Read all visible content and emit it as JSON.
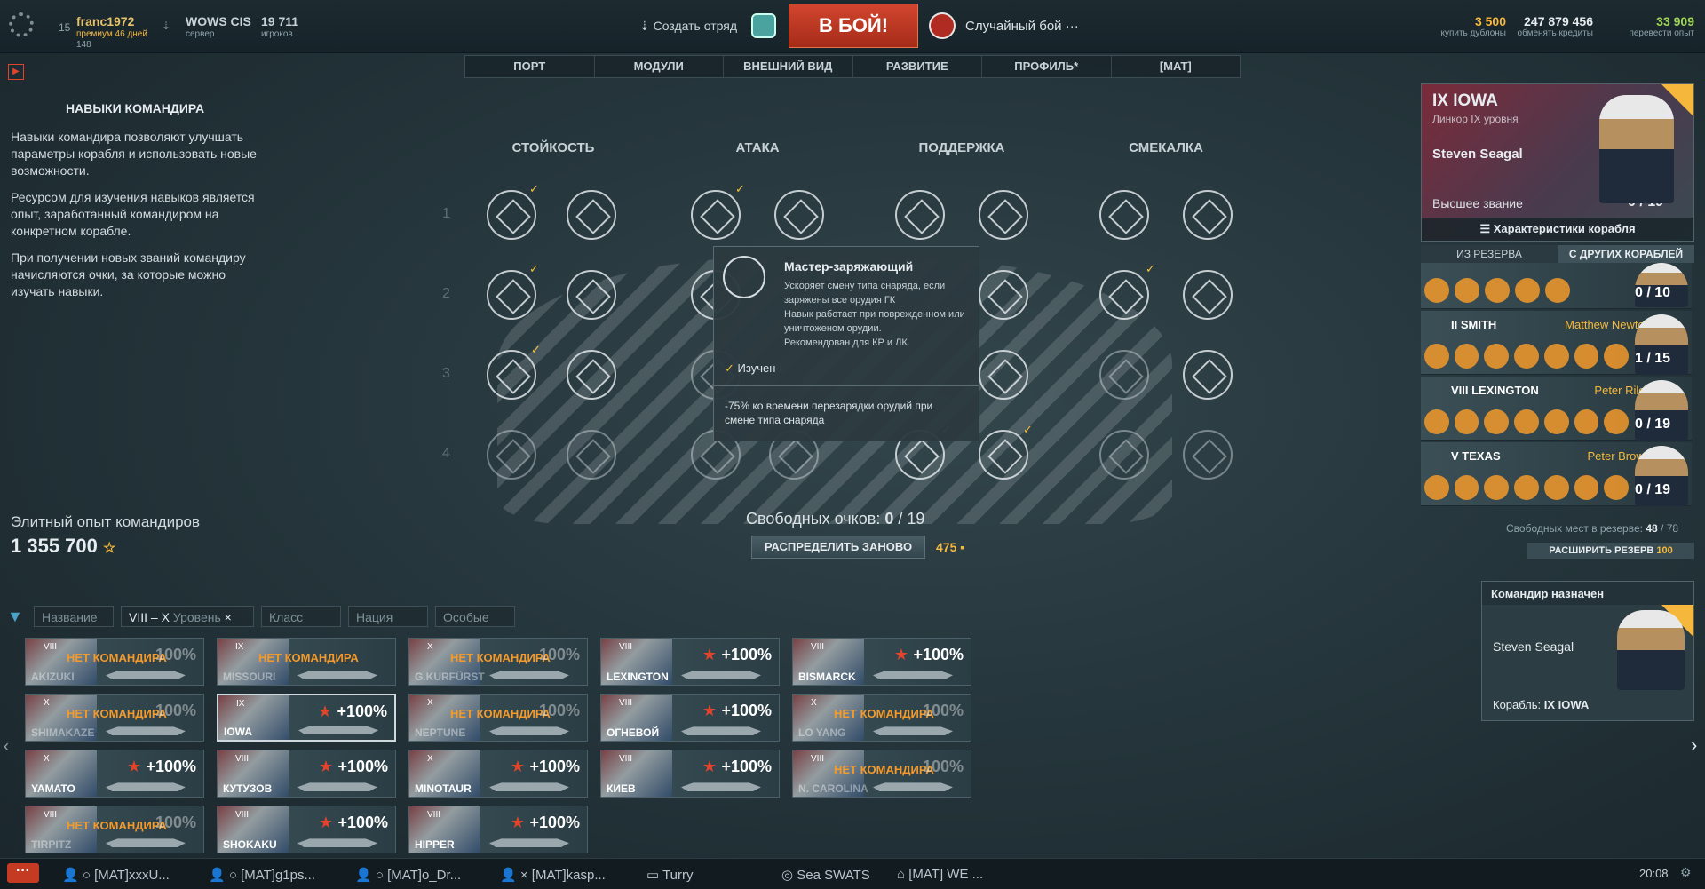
{
  "header": {
    "user": {
      "level": "15",
      "name": "franc1972",
      "premium": "премиум 46 дней",
      "exp": "148"
    },
    "server": {
      "name": "WOWS CIS",
      "label": "сервер"
    },
    "players": {
      "count": "19 711",
      "label": "игроков"
    },
    "create_squad": "Создать отряд",
    "battle_button": "В БОЙ!",
    "battle_mode": "Случайный бой",
    "currency": [
      {
        "value": "3 500",
        "label": "купить дублоны",
        "color": "#f5b83d"
      },
      {
        "value": "247 879 456",
        "label": "обменять кредиты",
        "color": "#e6ecef"
      },
      {
        "value": "33 909",
        "label": "перевести опыт",
        "color": "#9fd35a"
      }
    ]
  },
  "nav": {
    "tabs": [
      "ПОРТ",
      "МОДУЛИ",
      "ВНЕШНИЙ ВИД",
      "РАЗВИТИЕ",
      "ПРОФИЛЬ*"
    ],
    "clan": "[MAT]"
  },
  "info": {
    "title": "НАВЫКИ КОМАНДИРА",
    "p1": "Навыки командира позволяют улучшать параметры корабля и использовать новые возможности.",
    "p2": "Ресурсом для изучения навыков является опыт, заработанный командиром на конкретном корабле.",
    "p3": "При получении новых званий командиру начисляются очки, за которые можно изучать навыки.",
    "elite_label": "Элитный опыт командиров",
    "elite_value": "1 355 700"
  },
  "skills": {
    "columns": [
      "СТОЙКОСТЬ",
      "АТАКА",
      "ПОДДЕРЖКА",
      "СМЕКАЛКА"
    ],
    "rows": [
      "1",
      "2",
      "3",
      "4"
    ],
    "free_points_label": "Свободных очков:",
    "free_points": "0",
    "free_points_max": "19",
    "redistribute": "РАСПРЕДЕЛИТЬ ЗАНОВО",
    "redistribute_cost": "475"
  },
  "tooltip": {
    "title": "Мастер-заряжающий",
    "desc": "Ускоряет смену типа снаряда, если заряжены все орудия ГК\nНавык работает при поврежденном или уничтоженом орудии.\nРекомендован для КР и ЛК.",
    "status": "Изучен",
    "effect": "-75% ко времени перезарядки орудий при смене типа снаряда"
  },
  "commander": {
    "ship": "IX IOWA",
    "ship_type": "Линкор IX уровня",
    "name": "Steven Seagal",
    "rank": "Высшее звание",
    "points": "0 / 19",
    "ship_stats": "Характеристики корабля",
    "tab_reserve": "ИЗ РЕЗЕРВА",
    "tab_other": "С ДРУГИХ КОРАБЛЕЙ"
  },
  "reserve": [
    {
      "ship": "",
      "name": "",
      "points": "0 / 10"
    },
    {
      "ship": "II SMITH",
      "name": "Matthew Newton",
      "points": "1 / 15"
    },
    {
      "ship": "VIII LEXINGTON",
      "name": "Peter Riley",
      "points": "0 / 19"
    },
    {
      "ship": "V TEXAS",
      "name": "Peter Brown",
      "points": "0 / 19"
    }
  ],
  "reserve_free_label": "Свободных мест в резерве:",
  "reserve_free": "48",
  "reserve_max": "78",
  "expand_reserve": "РАСШИРИТЬ РЕЗЕРВ",
  "expand_cost": "100",
  "assigned": {
    "title": "Командир назначен",
    "name": "Steven Seagal",
    "ship_label": "Корабль:",
    "ship": "IX IOWA"
  },
  "filters": {
    "name": "Название",
    "tier_from": "VIII",
    "tier_dash": "–",
    "tier_to": "X",
    "tier": "Уровень",
    "class": "Класс",
    "nation": "Нация",
    "special": "Особые"
  },
  "nocmd": "НЕТ КОМАНДИРА",
  "ships": [
    {
      "tier": "VIII",
      "name": "AKIZUKI",
      "bonus": "100%",
      "nocmd": true
    },
    {
      "tier": "IX",
      "name": "MISSOURI",
      "bonus": "",
      "nocmd": true
    },
    {
      "tier": "X",
      "name": "G.KURFÜRST",
      "bonus": "100%",
      "nocmd": true
    },
    {
      "tier": "VIII",
      "name": "LEXINGTON",
      "bonus": "+100%",
      "nocmd": false
    },
    {
      "tier": "VIII",
      "name": "BISMARCK",
      "bonus": "+100%",
      "nocmd": false
    },
    {
      "tier": "X",
      "name": "SHIMAKAZE",
      "bonus": "100%",
      "nocmd": true
    },
    {
      "tier": "IX",
      "name": "IOWA",
      "bonus": "+100%",
      "nocmd": false
    },
    {
      "tier": "X",
      "name": "NEPTUNE",
      "bonus": "100%",
      "nocmd": true
    },
    {
      "tier": "VIII",
      "name": "ОГНЕВОЙ",
      "bonus": "+100%",
      "nocmd": false
    },
    {
      "tier": "X",
      "name": "LO YANG",
      "bonus": "100%",
      "nocmd": true
    },
    {
      "tier": "X",
      "name": "YAMATO",
      "bonus": "+100%",
      "nocmd": false
    },
    {
      "tier": "VIII",
      "name": "КУТУЗОВ",
      "bonus": "+100%",
      "nocmd": false
    },
    {
      "tier": "X",
      "name": "MINOTAUR",
      "bonus": "+100%",
      "nocmd": false
    },
    {
      "tier": "VIII",
      "name": "КИЕВ",
      "bonus": "+100%",
      "nocmd": false
    },
    {
      "tier": "VIII",
      "name": "N. CAROLINA",
      "bonus": "100%",
      "nocmd": true
    },
    {
      "tier": "VIII",
      "name": "TIRPITZ",
      "bonus": "100%",
      "nocmd": true
    },
    {
      "tier": "VIII",
      "name": "SHOKAKU",
      "bonus": "+100%",
      "nocmd": false
    },
    {
      "tier": "VIII",
      "name": "HIPPER",
      "bonus": "+100%",
      "nocmd": false
    }
  ],
  "chat": [
    "[MAT]xxxU...",
    "[MAT]g1ps...",
    "[MAT]o_Dr...",
    "[MAT]kasp...",
    "Turry",
    "Sea SWATS",
    "[MAT] WE ..."
  ],
  "clock": "20:08"
}
